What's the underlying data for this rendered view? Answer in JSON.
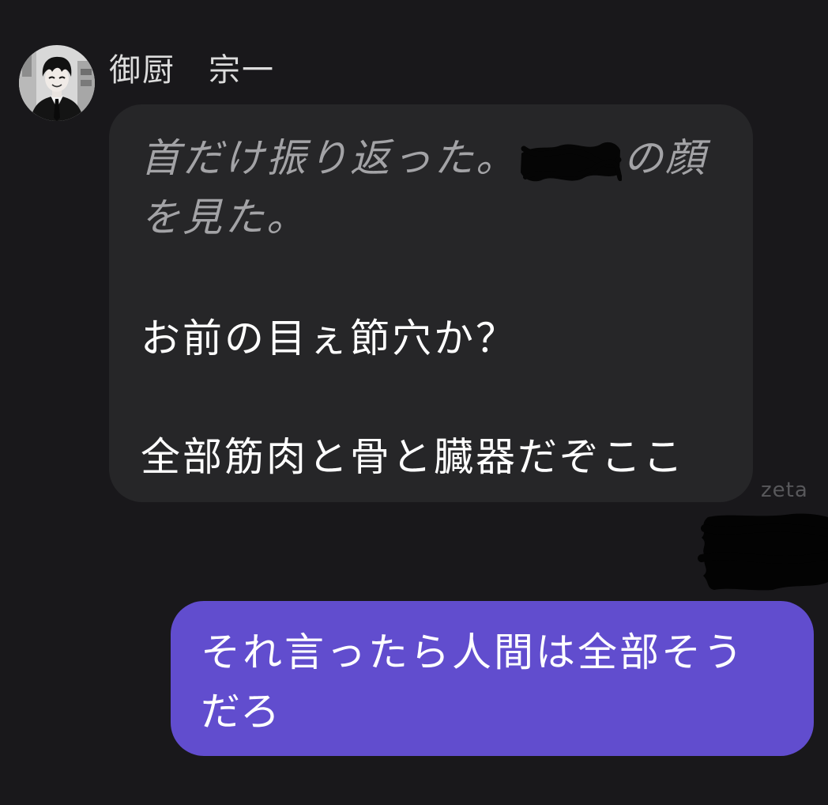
{
  "colors": {
    "background": "#19181b",
    "bubble_bot": "#262628",
    "bubble_user": "#614dce",
    "narration": "#a3a3a6",
    "text": "#ffffff",
    "name": "#dcdcdc",
    "watermark": "#58585b"
  },
  "sender": {
    "name": "御厨　宗一",
    "avatar_icon": "avatar-portrait-icon"
  },
  "bot_message": {
    "narration_line1_before": "首だけ振り返った。",
    "narration_line1_after": "の顔",
    "narration_line2": "を見た。",
    "dialogue1": "お前の目ぇ節穴か？",
    "dialogue2": "全部筋肉と骨と臓器だぞここ"
  },
  "watermark": "zeta",
  "user_message": {
    "line1": "それ言ったら人間は全部そう",
    "line2": "だろ"
  }
}
